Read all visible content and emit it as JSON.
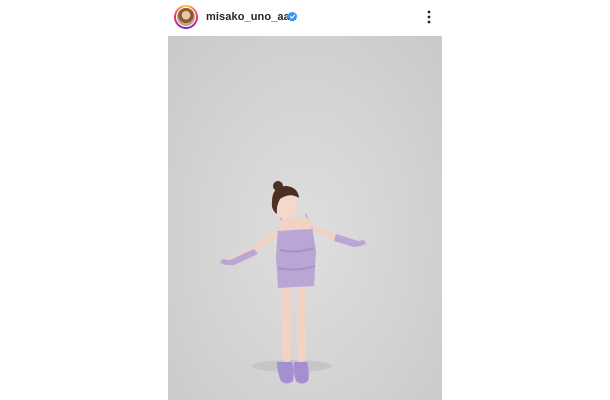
{
  "post": {
    "username": "misako_uno_aaa",
    "verified": true,
    "avatar_icon": "profile-avatar",
    "verified_icon": "verified-badge-icon",
    "more_icon": "more-options-icon"
  },
  "photo": {
    "backdrop_color": "#d6d6d6",
    "dress_color": "#b9a6d4",
    "shoe_color": "#a58fd0"
  }
}
